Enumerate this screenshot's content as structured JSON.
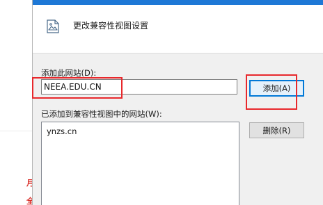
{
  "background": {
    "red_marks": [
      "月",
      "全"
    ]
  },
  "dialog": {
    "header": {
      "title": "更改兼容性视图设置",
      "icon": "compatibility-view-icon"
    },
    "add_site": {
      "label": "添加此网站(D):",
      "input_value": "NEEA.EDU.CN",
      "add_button_label": "添加(A)"
    },
    "site_list": {
      "label": "已添加到兼容性视图中的网站(W):",
      "items": [
        "ynzs.cn"
      ],
      "remove_button_label": "删除(R)"
    }
  },
  "annotation_color": "#e8282c",
  "accent_color": "#0078d7"
}
